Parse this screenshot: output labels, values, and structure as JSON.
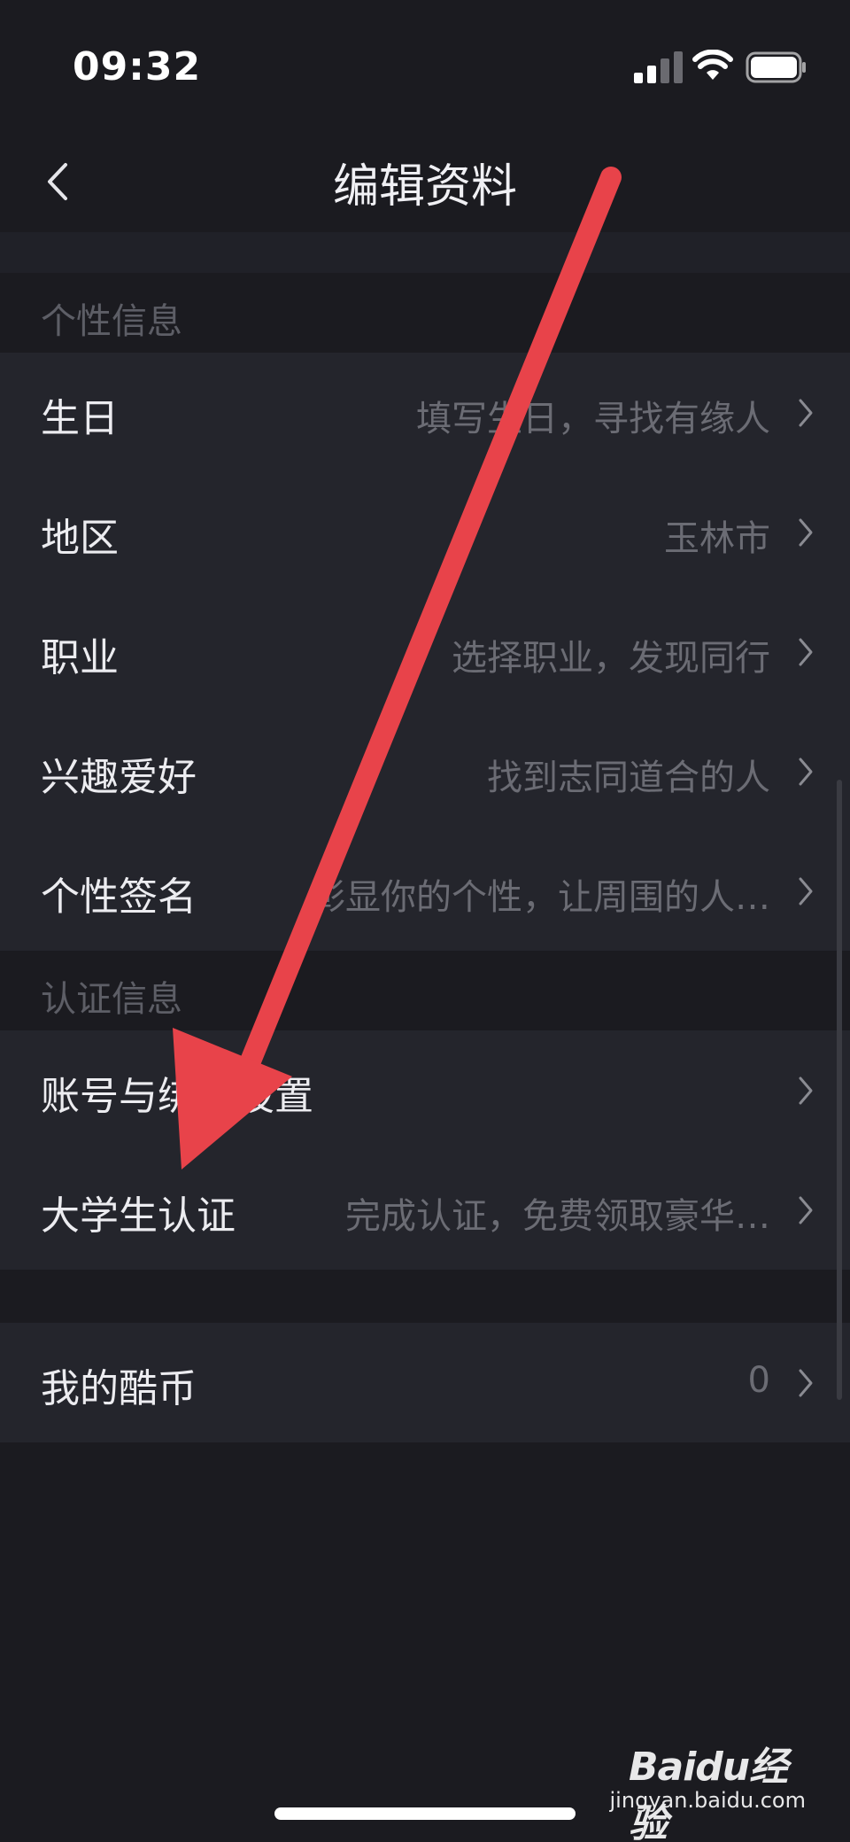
{
  "status_bar": {
    "time": "09:32"
  },
  "nav": {
    "title": "编辑资料",
    "back_icon": "chevron-left-icon"
  },
  "sections": {
    "personal": {
      "header": "个性信息",
      "rows": [
        {
          "label": "生日",
          "value": "填写生日，寻找有缘人"
        },
        {
          "label": "地区",
          "value": "玉林市"
        },
        {
          "label": "职业",
          "value": "选择职业，发现同行"
        },
        {
          "label": "兴趣爱好",
          "value": "找到志同道合的人"
        },
        {
          "label": "个性签名",
          "value": "彰显你的个性，让周围的人…"
        }
      ]
    },
    "verification": {
      "header": "认证信息",
      "rows": [
        {
          "label": "账号与绑定设置",
          "value": ""
        },
        {
          "label": "大学生认证",
          "value": "完成认证，免费领取豪华…"
        }
      ]
    },
    "coins": {
      "rows": [
        {
          "label": "我的酷币",
          "value": "0"
        }
      ]
    }
  },
  "watermark": {
    "logo": "Baidu经验",
    "url": "jingyan.baidu.com"
  },
  "colors": {
    "background": "#1b1b20",
    "row_background": "#24252c",
    "arrow": "#e8434a"
  }
}
